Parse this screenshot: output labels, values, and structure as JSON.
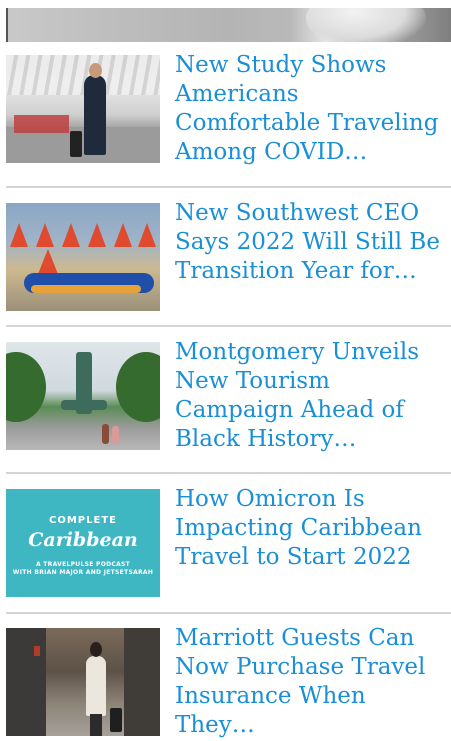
{
  "hero": {
    "image_alt": "Top story image"
  },
  "articles": [
    {
      "title": "New Study Shows Americans Comfortable Traveling Among COVID…",
      "image_alt": "Traveler in airport terminal"
    },
    {
      "title": "New Southwest CEO Says 2022 Will Still Be Transition Year for…",
      "image_alt": "Southwest airplanes"
    },
    {
      "title": "Montgomery Unveils New Tourism Campaign Ahead of Black History…",
      "image_alt": "Montgomery fountain"
    },
    {
      "title": "How Omicron Is Impacting Caribbean Travel to Start 2022",
      "image_alt": "Complete Caribbean podcast"
    },
    {
      "title": "Marriott Guests Can Now Purchase Travel Insurance When They…",
      "image_alt": "Guest with suitcase in hotel lobby"
    }
  ],
  "podcast": {
    "line1": "COMPLETE",
    "line2": "Caribbean",
    "line3": "A TRAVELPULSE PODCAST",
    "line4": "WITH BRIAN MAJOR AND JETSETSARAH"
  },
  "colors": {
    "link": "#1a8fd6",
    "divider": "#d4d4d4",
    "podcast_bg": "#3fb7c3"
  }
}
